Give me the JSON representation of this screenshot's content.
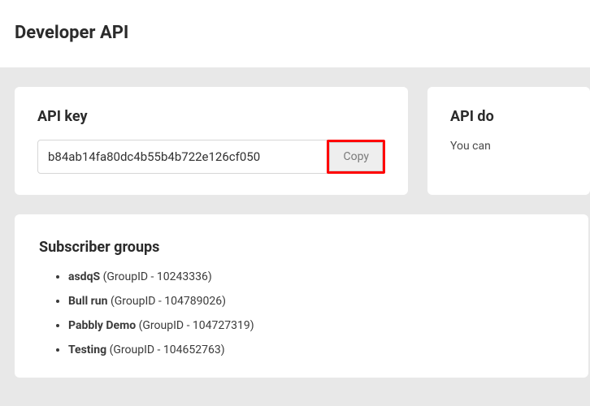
{
  "page": {
    "title": "Developer API"
  },
  "api_key": {
    "title": "API key",
    "value": "b84ab14fa80dc4b55b4b722e126cf050",
    "copy_label": "Copy"
  },
  "api_docs": {
    "title": "API do",
    "text": "You can "
  },
  "groups": {
    "title": "Subscriber groups",
    "items": [
      {
        "name": "asdqS",
        "id_label": " (GroupID - 10243336)"
      },
      {
        "name": "Bull run",
        "id_label": " (GroupID - 104789026)"
      },
      {
        "name": "Pabbly Demo",
        "id_label": " (GroupID - 104727319)"
      },
      {
        "name": "Testing",
        "id_label": " (GroupID - 104652763)"
      }
    ]
  }
}
